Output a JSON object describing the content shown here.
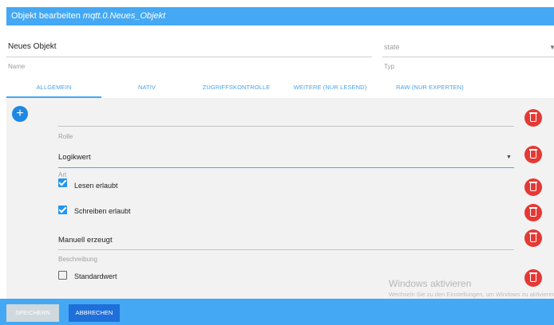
{
  "dialog": {
    "title_prefix": "Objekt bearbeiten",
    "title_object": "mqtt.0.Neues_Objekt"
  },
  "header": {
    "name_value": "Neues Objekt",
    "name_label": "Name",
    "type_value": "state",
    "type_label": "Typ"
  },
  "tabs": [
    {
      "label": "ALLGEMEIN",
      "active": true
    },
    {
      "label": "NATIV"
    },
    {
      "label": "ZUGRIFFSKONTROLLE"
    },
    {
      "label": "WEITERE (NUR LESEND)"
    },
    {
      "label": "RAW (NUR EXPERTEN)"
    }
  ],
  "form": {
    "add_symbol": "+",
    "role_label": "Rolle",
    "type_select_value": "Logikwert",
    "type_select_label": "Art",
    "read_label": "Lesen erlaubt",
    "read_checked": true,
    "write_label": "Schreiben erlaubt",
    "write_checked": true,
    "description_value": "Manuell erzeugt",
    "description_label": "Beschreibung",
    "default_label": "Standardwert",
    "default_checked": false
  },
  "watermark": {
    "title": "Windows aktivieren",
    "subtitle": "Wechseln Sie zu den Einstellungen, um Windows zu aktivieren."
  },
  "footer": {
    "save_label": "SPEICHERN",
    "cancel_label": "ABBRECHEN"
  },
  "colors": {
    "accent": "#44a8f4",
    "delete": "#e53935",
    "add": "#1e88e5",
    "checkbox": "#2196f3"
  }
}
